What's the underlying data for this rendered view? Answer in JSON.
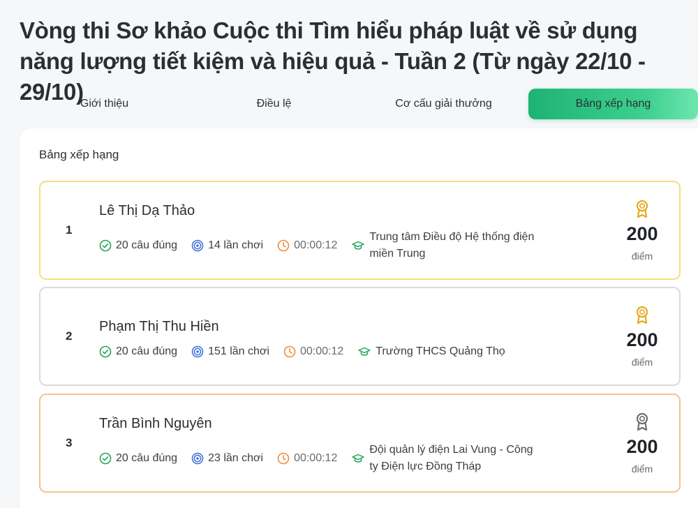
{
  "page": {
    "title": "Vòng thi Sơ khảo Cuộc thi Tìm hiểu pháp luật về sử dụng năng lượng tiết kiệm và hiệu quả - Tuần 2 (Từ ngày 22/10 - 29/10)"
  },
  "tabs": [
    {
      "label": "Giới thiệu",
      "active": false
    },
    {
      "label": "Điều lệ",
      "active": false
    },
    {
      "label": "Cơ cấu giải thưởng",
      "active": false
    },
    {
      "label": "Bảng xếp hạng",
      "active": true
    }
  ],
  "leaderboard": {
    "title": "Bảng xếp hạng",
    "entries": [
      {
        "rank": "1",
        "name": "Lê Thị Dạ Thảo",
        "correct": "20 câu đúng",
        "plays": "14 lần chơi",
        "time": "00:00:12",
        "school": "Trung tâm Điều độ Hệ thống điện miền Trung",
        "score": "200",
        "unit": "điểm",
        "medal": "award-gold-icon"
      },
      {
        "rank": "2",
        "name": "Phạm Thị Thu Hiền",
        "correct": "20 câu đúng",
        "plays": "151 lần chơi",
        "time": "00:00:12",
        "school": "Trường THCS Quảng Thọ",
        "score": "200",
        "unit": "điểm",
        "medal": "award-gold-icon"
      },
      {
        "rank": "3",
        "name": "Trần Bình Nguyên",
        "correct": "20 câu đúng",
        "plays": "23 lần chơi",
        "time": "00:00:12",
        "school": "Đội quản lý điện Lai Vung - Công ty Điện lực Đồng Tháp",
        "score": "200",
        "unit": "điểm",
        "medal": "award-gray-icon"
      }
    ]
  },
  "colors": {
    "accent_green": "#1db374",
    "check_green": "#22a35a",
    "target_blue": "#3d6fd8",
    "clock_orange": "#ef8c3a",
    "medal_gold": "#e6a91e",
    "medal_gray": "#6b6f75",
    "border_gold": "#f5e07a",
    "border_bronze": "#f2c48f"
  }
}
